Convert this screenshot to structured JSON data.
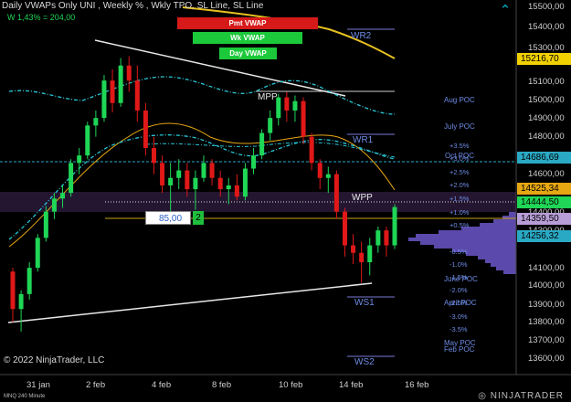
{
  "title": "Daily VWAPs Only  UNI , Weekly % , Wkly TPO, SL Line, SL Line",
  "subtitle": "W 1,43% = 204,00",
  "buttons": {
    "pmt_vwap": "Pmt VWAP",
    "wk_vwap": "Wk VWAP",
    "day_vwap": "Day VWAP"
  },
  "colors": {
    "pmt_vwap": "#d61a1a",
    "wk_vwap": "#1cc93a",
    "day_vwap": "#1cc93a",
    "up_candle": "#1fd656",
    "down_candle": "#e01818",
    "cyan_line": "#28c8d8",
    "orange_line": "#e6a712",
    "yellow_line": "#e6c020",
    "axis_text": "#cfcfcf",
    "level_text": "#6e8ce6"
  },
  "levels": {
    "wr2": "WR2",
    "wr1": "WR1",
    "wpp": "WPP",
    "ws1": "WS1",
    "ws2": "WS2",
    "mpp": "MPP"
  },
  "poc": {
    "aug": "Aug POC",
    "july": "July POC",
    "oct": "Oct POC",
    "june": "June POC",
    "april": "April POC",
    "may": "May POC",
    "feb": "Feb POC"
  },
  "percent_levels": [
    "+3.5%",
    "+3.0%",
    "+2.5%",
    "+2.0%",
    "+1.5%",
    "+1.0%",
    "+0.5%",
    "-0.5%",
    "-1.0%",
    "-1.5%",
    "-2.0%",
    "-2.5%",
    "-3.0%",
    "-3.5%"
  ],
  "y_axis": {
    "ticks": [
      "15500,00",
      "15400,00",
      "15300,00",
      "15100,00",
      "15000,00",
      "14900,00",
      "14800,00",
      "14600,00",
      "14400,00",
      "14300,00",
      "14100,00",
      "14000,00",
      "13900,00",
      "13800,00",
      "13700,00",
      "13600,00"
    ]
  },
  "price_badges": [
    {
      "text": "15216,70",
      "bg": "#f2d100",
      "fg": "#000000"
    },
    {
      "text": "14686,69",
      "bg": "#2aa9c4",
      "fg": "#000000"
    },
    {
      "text": "14525,34",
      "bg": "#e6a712",
      "fg": "#000000"
    },
    {
      "text": "14444,50",
      "bg": "#1fd656",
      "fg": "#000000"
    },
    {
      "text": "14359,50",
      "bg": "#b89ed8",
      "fg": "#000000"
    },
    {
      "text": "14256,32",
      "bg": "#2aa9c4",
      "fg": "#000000"
    }
  ],
  "x_axis": {
    "labels": [
      "31 jan",
      "2 feb",
      "4 feb",
      "8 feb",
      "10 feb",
      "14 feb",
      "16 feb"
    ]
  },
  "order_entry": {
    "value": "85,00",
    "step": "2"
  },
  "footer": {
    "copyright": "© 2022 NinjaTrader, LLC",
    "instrument": "MNQ 240 Minute",
    "logo": "NINJATRADER"
  },
  "chart_data": {
    "type": "candlestick",
    "title": "Daily VWAPs Only  UNI , Weekly % , Wkly TPO, SL Line, SL Line",
    "x_categories": [
      "31 jan",
      "2 feb",
      "4 feb",
      "8 feb",
      "10 feb",
      "14 feb",
      "16 feb"
    ],
    "ylim": [
      13550,
      15550
    ],
    "ohlc": [
      [
        14100,
        14120,
        13830,
        13900
      ],
      [
        13900,
        14000,
        13780,
        13980
      ],
      [
        13980,
        14150,
        13950,
        14120
      ],
      [
        14120,
        14300,
        14100,
        14280
      ],
      [
        14280,
        14450,
        14260,
        14420
      ],
      [
        14420,
        14520,
        14380,
        14490
      ],
      [
        14490,
        14560,
        14440,
        14520
      ],
      [
        14520,
        14700,
        14500,
        14680
      ],
      [
        14680,
        14760,
        14620,
        14720
      ],
      [
        14720,
        14900,
        14700,
        14880
      ],
      [
        14880,
        14960,
        14820,
        14920
      ],
      [
        14920,
        15150,
        14900,
        15120
      ],
      [
        15120,
        15180,
        14950,
        15000
      ],
      [
        15000,
        15240,
        14980,
        15200
      ],
      [
        15200,
        15250,
        15060,
        15120
      ],
      [
        15120,
        15200,
        14900,
        14960
      ],
      [
        14960,
        15000,
        14720,
        14760
      ],
      [
        14760,
        14820,
        14620,
        14680
      ],
      [
        14680,
        14720,
        14520,
        14560
      ],
      [
        14560,
        14680,
        14380,
        14600
      ],
      [
        14600,
        14700,
        14540,
        14640
      ],
      [
        14640,
        14680,
        14500,
        14540
      ],
      [
        14540,
        14640,
        14430,
        14600
      ],
      [
        14600,
        14720,
        14580,
        14680
      ],
      [
        14680,
        14700,
        14560,
        14600
      ],
      [
        14600,
        14640,
        14500,
        14540
      ],
      [
        14540,
        14600,
        14460,
        14560
      ],
      [
        14560,
        14620,
        14480,
        14500
      ],
      [
        14500,
        14680,
        14480,
        14650
      ],
      [
        14650,
        14760,
        14620,
        14720
      ],
      [
        14720,
        14860,
        14700,
        14840
      ],
      [
        14840,
        14960,
        14800,
        14920
      ],
      [
        14920,
        15050,
        14880,
        15030
      ],
      [
        15030,
        15060,
        14900,
        14960
      ],
      [
        14960,
        15040,
        14900,
        15010
      ],
      [
        15010,
        15030,
        14780,
        14820
      ],
      [
        14820,
        14840,
        14640,
        14680
      ],
      [
        14680,
        14700,
        14540,
        14600
      ],
      [
        14600,
        14660,
        14520,
        14620
      ],
      [
        14620,
        14640,
        14380,
        14420
      ],
      [
        14420,
        14440,
        14180,
        14240
      ],
      [
        14240,
        14300,
        14140,
        14200
      ],
      [
        14200,
        14260,
        14040,
        14150
      ],
      [
        14150,
        14280,
        14080,
        14240
      ],
      [
        14240,
        14340,
        14200,
        14320
      ],
      [
        14320,
        14340,
        14180,
        14240
      ],
      [
        14240,
        14460,
        14220,
        14444.5
      ]
    ]
  }
}
